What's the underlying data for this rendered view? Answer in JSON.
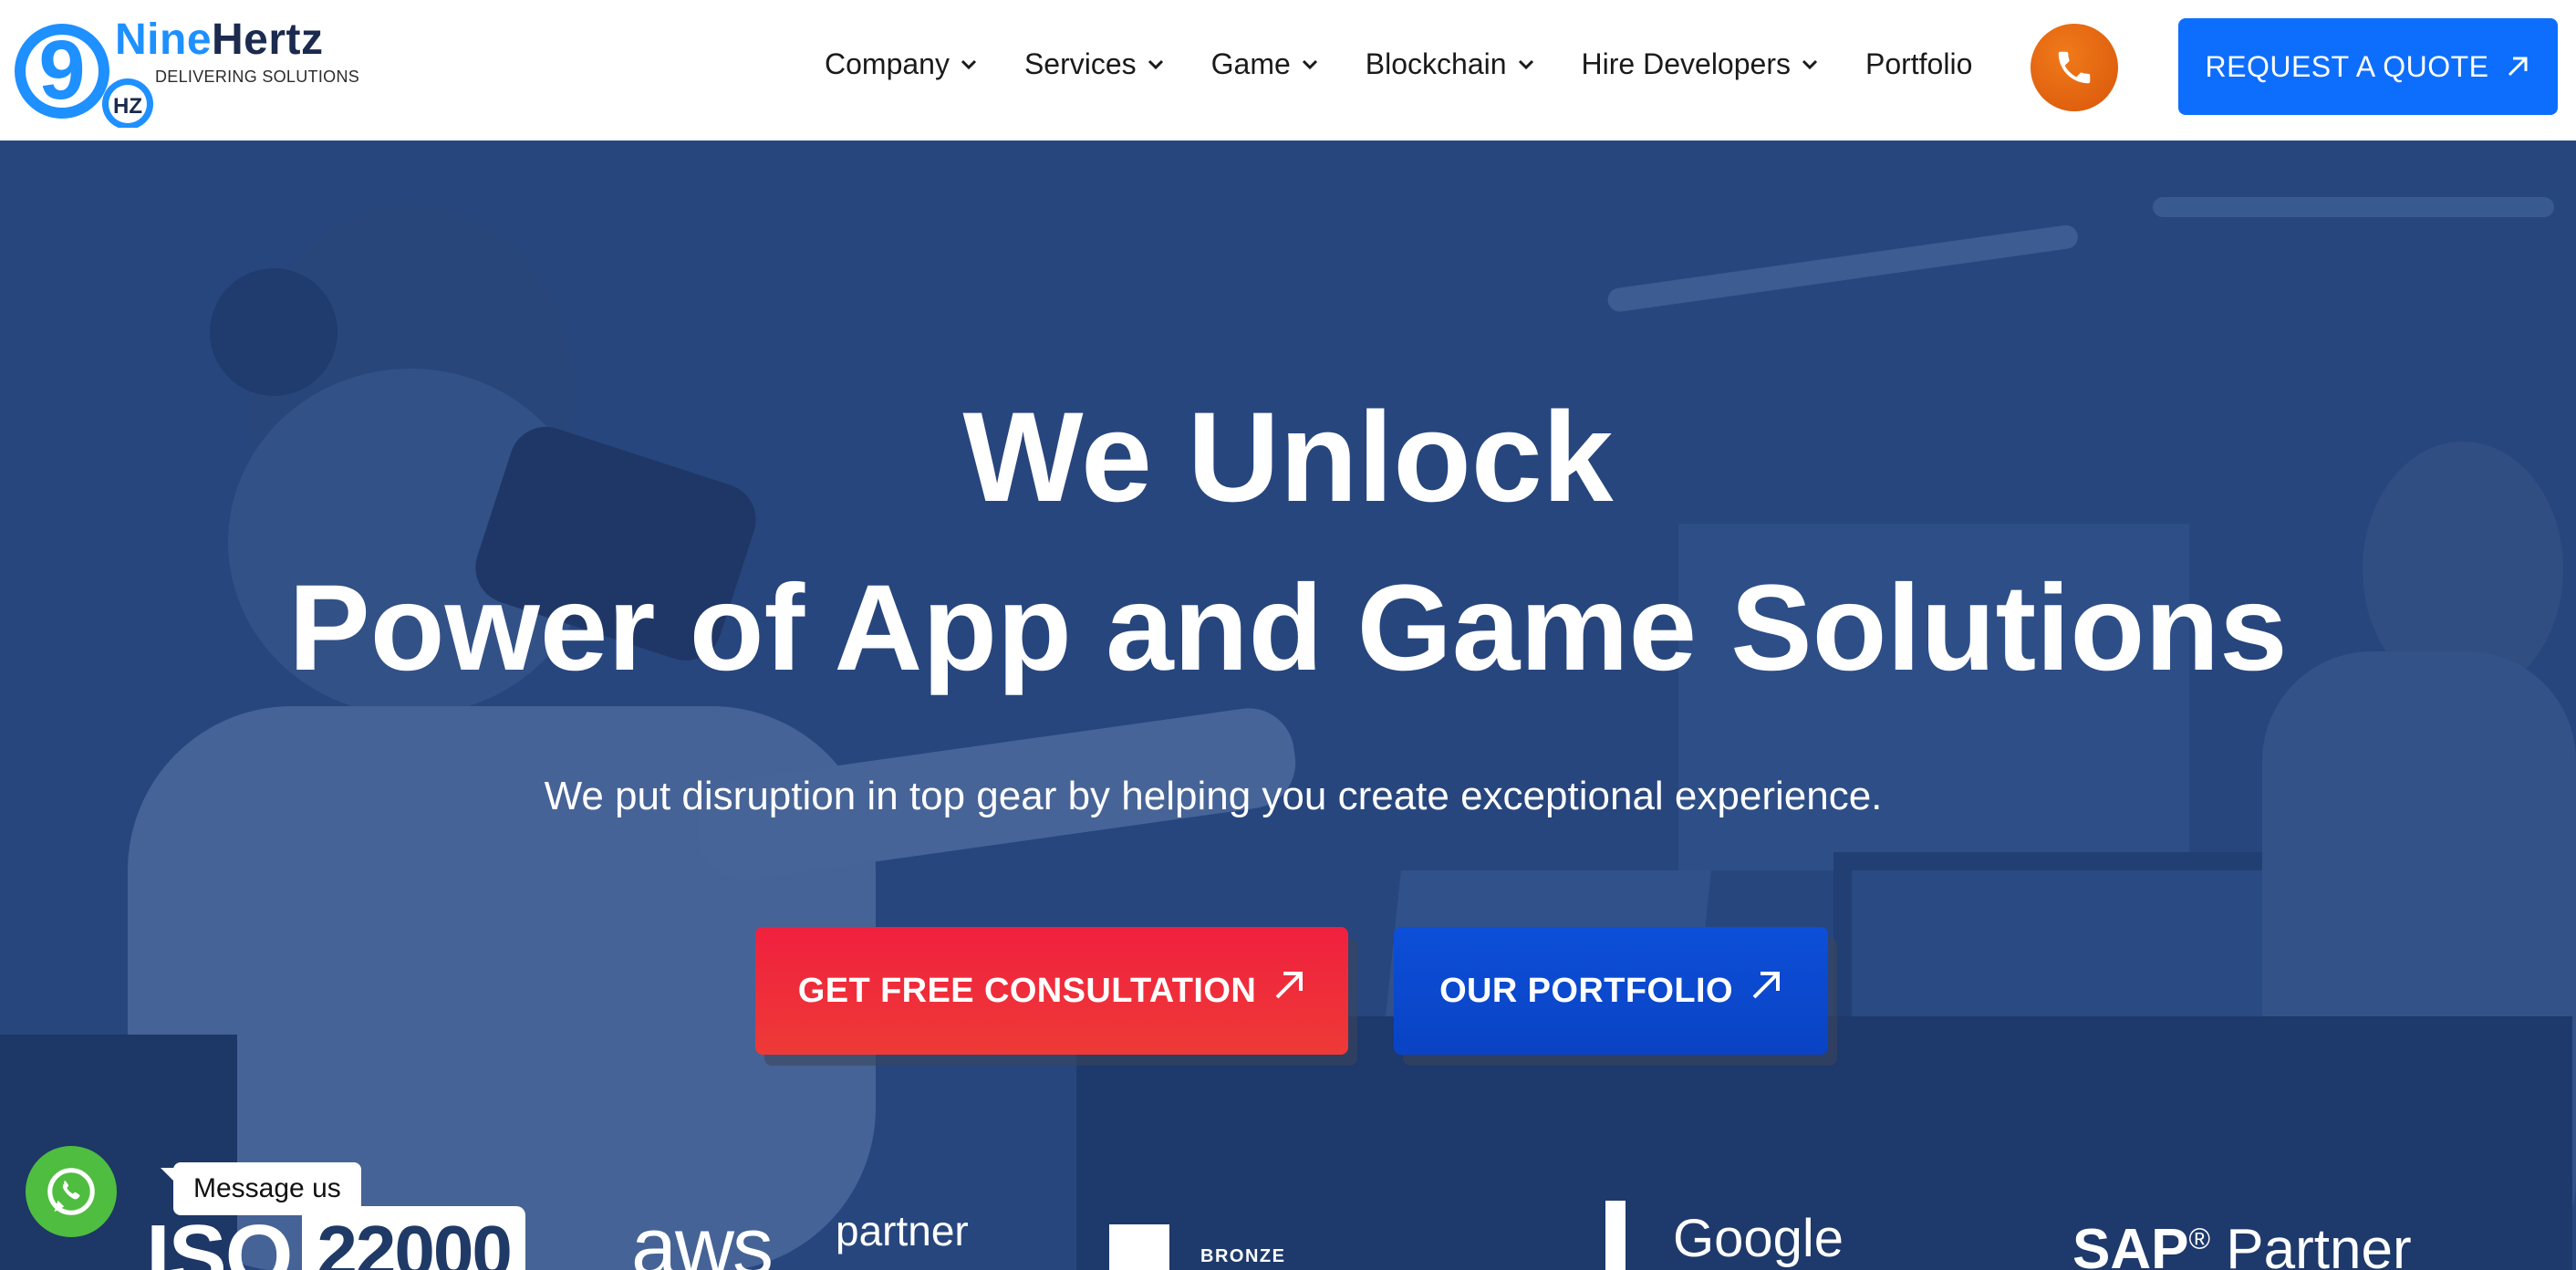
{
  "header": {
    "logo": {
      "mark_text": "9",
      "hz_text": "HZ",
      "name_part1": "Nine",
      "name_part2": "Hertz",
      "tagline": "DELIVERING SOLUTIONS"
    },
    "nav": [
      {
        "label": "Company",
        "has_dropdown": true
      },
      {
        "label": "Services",
        "has_dropdown": true
      },
      {
        "label": "Game",
        "has_dropdown": true
      },
      {
        "label": "Blockchain",
        "has_dropdown": true
      },
      {
        "label": "Hire Developers",
        "has_dropdown": true
      },
      {
        "label": "Portfolio",
        "has_dropdown": false
      }
    ],
    "phone_icon": "phone-icon",
    "quote_button": "REQUEST A QUOTE"
  },
  "hero": {
    "title_line1": "We Unlock",
    "title_line2": "Power of App and Game Solutions",
    "subtitle": "We put disruption in top gear by helping you create exceptional experience.",
    "cta_primary": "GET FREE CONSULTATION",
    "cta_secondary": "OUR PORTFOLIO"
  },
  "partners": {
    "iso": "ISO",
    "iso_number": "22000",
    "aws": "aws",
    "aws_partner": "partner",
    "bronze": "BRONZE",
    "google": "Google",
    "sap": "SAP",
    "sap_reg": "®",
    "sap_partner": " Partner"
  },
  "whatsapp": {
    "icon": "whatsapp-icon",
    "label": "Message us"
  },
  "colors": {
    "brand_blue": "#1e90ff",
    "quote_button": "#0d6efd",
    "phone_button": "#e8640e",
    "cta_consult": "#f0203f",
    "cta_portfolio": "#0c4fd8",
    "hero_overlay": "#2a4a7f",
    "whatsapp": "#4fbd40"
  }
}
